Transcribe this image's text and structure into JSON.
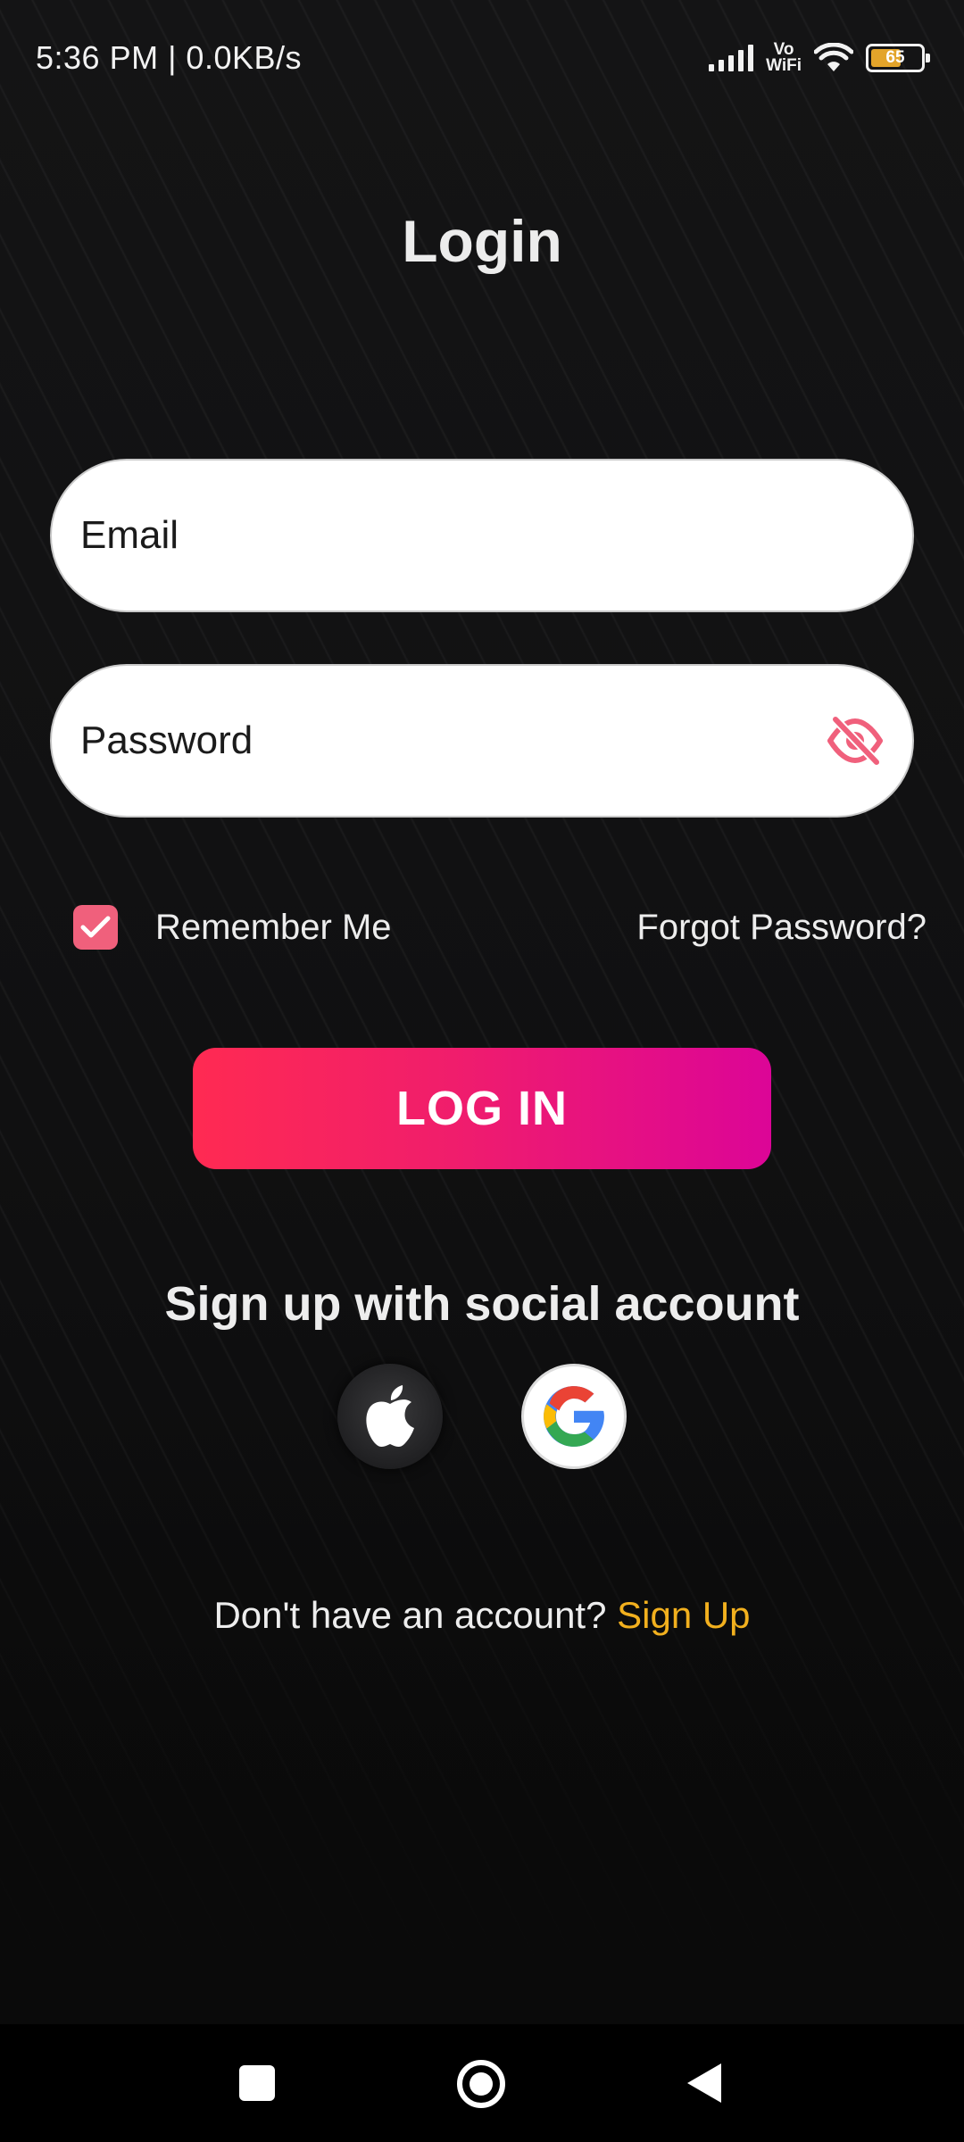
{
  "status_bar": {
    "time_speed": "5:36 PM | 0.0KB/s",
    "vowifi_line1": "Vo",
    "vowifi_line2": "WiFi",
    "battery_level": "65",
    "battery_fraction": 0.65,
    "icons": [
      "signal-icon",
      "vowifi-icon",
      "wifi-icon",
      "battery-icon"
    ]
  },
  "page": {
    "title": "Login"
  },
  "form": {
    "email_placeholder": "Email",
    "email_value": "",
    "password_placeholder": "Password",
    "password_value": "",
    "password_toggle_icon": "eye-off-icon",
    "remember_label": "Remember Me",
    "remember_checked": true,
    "forgot_label": "Forgot Password?",
    "login_label": "LOG IN"
  },
  "social": {
    "title": "Sign up with social account",
    "providers": [
      "apple-icon",
      "google-icon"
    ]
  },
  "footer": {
    "prompt": "Don't have an account? ",
    "signup_label": "Sign Up"
  },
  "nav_bar": {
    "icons": [
      "recent-apps-icon",
      "home-icon",
      "back-icon"
    ]
  },
  "colors": {
    "accent_pink": "#f0607c",
    "button_gradient_start": "#ff2a52",
    "button_gradient_end": "#dc0597",
    "link_yellow": "#f2b01e",
    "background": "#111112"
  }
}
